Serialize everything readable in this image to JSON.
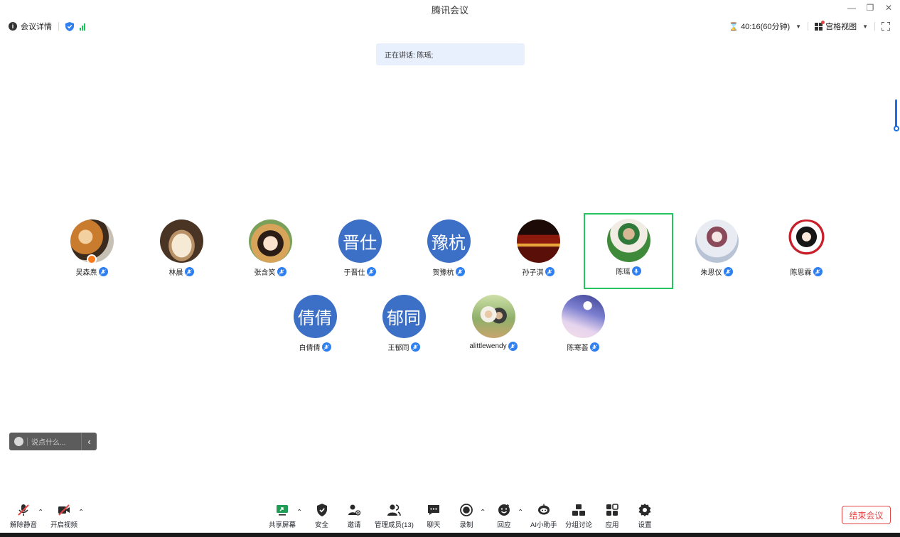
{
  "window": {
    "title": "腾讯会议",
    "controls": [
      "minimize",
      "restore",
      "close"
    ]
  },
  "infobar": {
    "details_label": "会议详情",
    "timer": "40:16(60分钟)",
    "view_mode": "宫格视图"
  },
  "speaking": "正在讲话: 陈瑶;",
  "participants": [
    {
      "name": "吴森焘",
      "avatar": "photo",
      "host": true
    },
    {
      "name": "林晨",
      "avatar": "photo"
    },
    {
      "name": "张含笑",
      "avatar": "photo"
    },
    {
      "name": "于晋仕",
      "avatar_text": "晋仕"
    },
    {
      "name": "贺豫杭",
      "avatar_text": "豫杭"
    },
    {
      "name": "孙子淇",
      "avatar": "photo"
    },
    {
      "name": "陈瑶",
      "avatar": "photo",
      "speaking": true
    },
    {
      "name": "朱思仪",
      "avatar": "photo"
    },
    {
      "name": "陈思霖",
      "avatar": "photo"
    },
    {
      "name": "白倩倩",
      "avatar_text": "倩倩"
    },
    {
      "name": "王郁同",
      "avatar_text": "郁同"
    },
    {
      "name": "alittlewendy",
      "avatar": "photo"
    },
    {
      "name": "陈寒荟",
      "avatar": "photo"
    }
  ],
  "chat": {
    "placeholder": "说点什么..."
  },
  "toolbar": {
    "unmute": "解除静音",
    "start_video": "开启视频",
    "share_screen": "共享屏幕",
    "security": "安全",
    "invite": "邀请",
    "manage_members": "管理成员(13)",
    "chat": "聊天",
    "record": "录制",
    "reactions": "回应",
    "ai_assistant": "AI小助手",
    "breakout": "分组讨论",
    "apps": "应用",
    "settings": "设置",
    "end_meeting": "结束会议"
  },
  "colors": {
    "accent": "#2f7ff0",
    "text_avatar_bg": "#3c6fc6",
    "speaking_border": "#22c55e",
    "end_button": "#e54545",
    "banner_bg": "#e8f0fd"
  }
}
